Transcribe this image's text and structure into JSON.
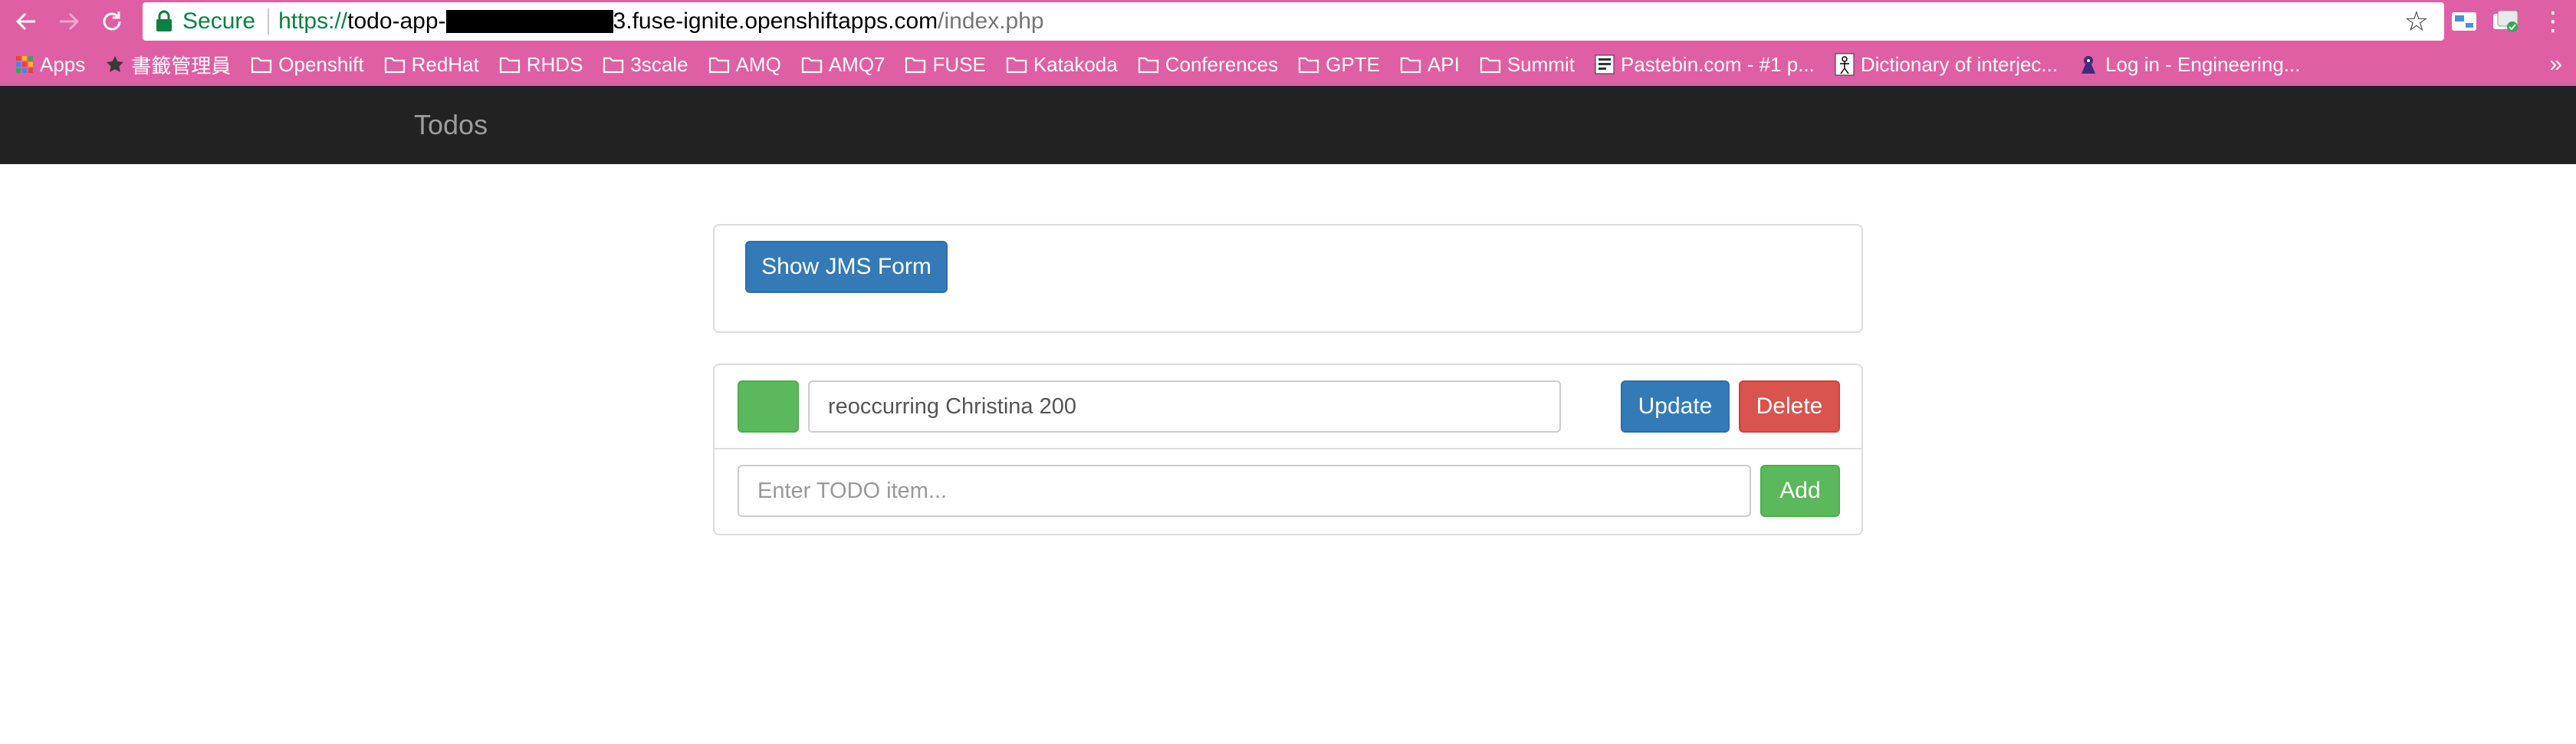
{
  "browser": {
    "secure_label": "Secure",
    "url_scheme": "https://",
    "url_host_prefix": "todo-app-",
    "url_host_suffix": "3.fuse-ignite.openshiftapps.com",
    "url_path": "/index.php",
    "bookmarks": [
      {
        "label": "Apps",
        "icon": "apps-grid-icon"
      },
      {
        "label": "書籤管理員",
        "icon": "star-icon"
      },
      {
        "label": "Openshift",
        "icon": "folder-icon"
      },
      {
        "label": "RedHat",
        "icon": "folder-icon"
      },
      {
        "label": "RHDS",
        "icon": "folder-icon"
      },
      {
        "label": "3scale",
        "icon": "folder-icon"
      },
      {
        "label": "AMQ",
        "icon": "folder-icon"
      },
      {
        "label": "AMQ7",
        "icon": "folder-icon"
      },
      {
        "label": "FUSE",
        "icon": "folder-icon"
      },
      {
        "label": "Katakoda",
        "icon": "folder-icon"
      },
      {
        "label": "Conferences",
        "icon": "folder-icon"
      },
      {
        "label": "GPTE",
        "icon": "folder-icon"
      },
      {
        "label": "API",
        "icon": "folder-icon"
      },
      {
        "label": "Summit",
        "icon": "folder-icon"
      },
      {
        "label": "Pastebin.com - #1 p...",
        "icon": "pastebin-icon"
      },
      {
        "label": "Dictionary of interjec...",
        "icon": "dictionary-icon"
      },
      {
        "label": "Log in - Engineering...",
        "icon": "engineering-icon"
      }
    ],
    "overflow": "»",
    "colors": {
      "chrome": "#df5fa4",
      "secure": "#0b8043"
    }
  },
  "navbar": {
    "brand": "Todos"
  },
  "jms": {
    "show_button": "Show JMS Form"
  },
  "todos": {
    "items": [
      {
        "text": "reoccurring Christina 200",
        "status_color": "#5cb85c",
        "update_label": "Update",
        "delete_label": "Delete"
      }
    ],
    "new_item_placeholder": "Enter TODO item...",
    "add_label": "Add"
  }
}
